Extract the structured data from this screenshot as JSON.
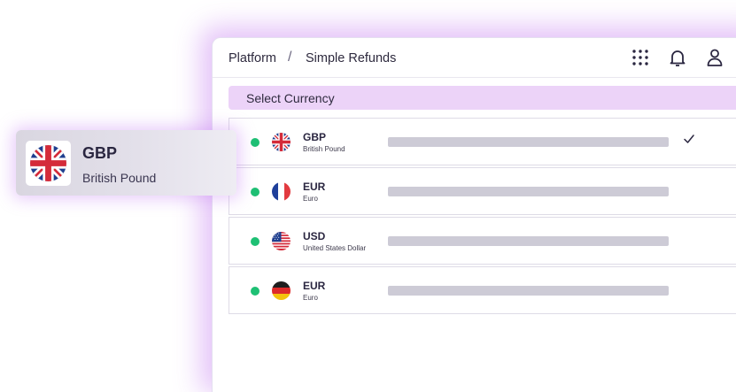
{
  "topbar": {
    "breadcrumb": [
      "Platform",
      "Simple Refunds"
    ],
    "separator": "/",
    "icons": [
      "apps-grid-icon",
      "bell-icon",
      "user-icon"
    ]
  },
  "select_label": "Select Currency",
  "currencies": [
    {
      "code": "GBP",
      "name": "British Pound",
      "flag": "uk-flag-icon",
      "status": "active",
      "selected": true
    },
    {
      "code": "EUR",
      "name": "Euro",
      "flag": "france-flag-icon",
      "status": "active",
      "selected": false
    },
    {
      "code": "USD",
      "name": "United States Dollar",
      "flag": "us-flag-icon",
      "status": "active",
      "selected": false
    },
    {
      "code": "EUR",
      "name": "Euro",
      "flag": "germany-flag-icon",
      "status": "active",
      "selected": false
    }
  ],
  "selected_card": {
    "code": "GBP",
    "name": "British Pound",
    "flag": "uk-flag-icon"
  },
  "colors": {
    "accent": "#ecd3f8",
    "glow": "#c478f0",
    "status_active": "#1ec074",
    "placeholder": "#cdcbd6"
  }
}
